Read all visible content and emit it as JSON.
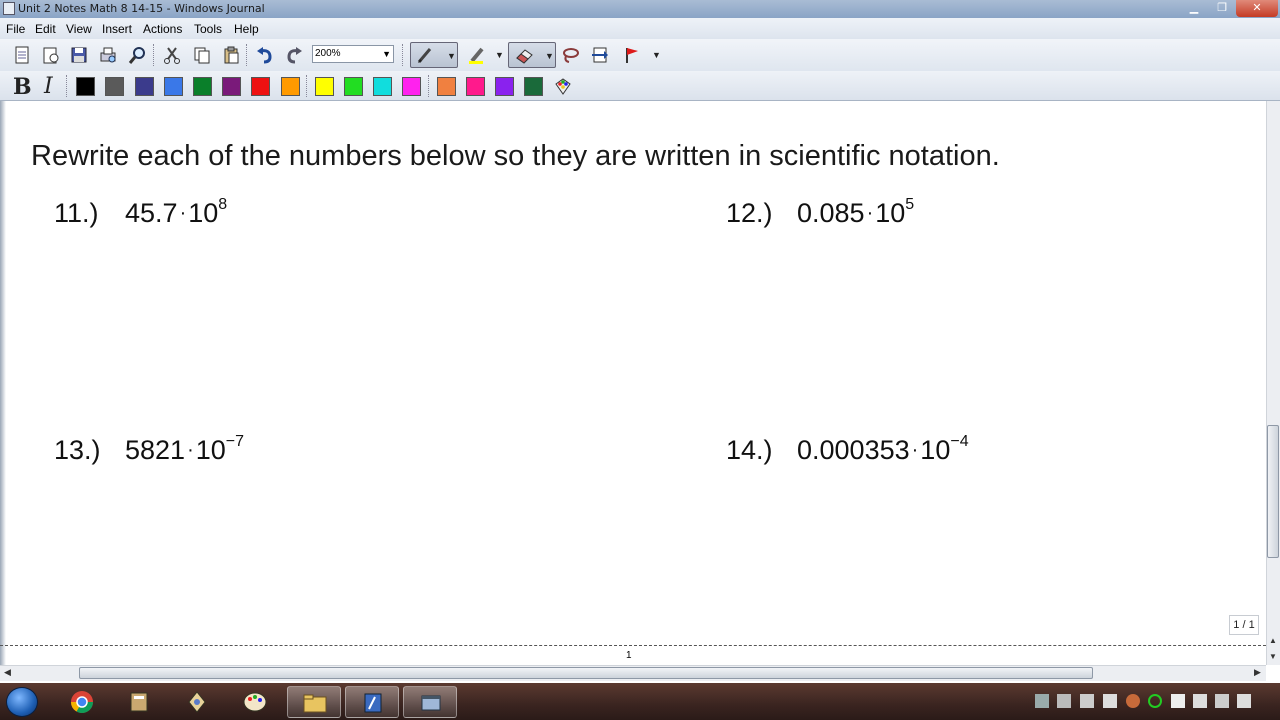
{
  "window": {
    "title": "Unit 2 Notes Math 8 14-15 - Windows Journal"
  },
  "menu": [
    "File",
    "Edit",
    "View",
    "Insert",
    "Actions",
    "Tools",
    "Help"
  ],
  "toolbar": {
    "zoom": "200%"
  },
  "colors": [
    "#000000",
    "#5a5a5a",
    "#3b3b8c",
    "#3a78e8",
    "#0a7f2a",
    "#7a1a7a",
    "#ee1111",
    "#ff9a00",
    "#ffff00",
    "#22dd22",
    "#11dddd",
    "#ff22ee",
    "#f08040",
    "#ff1a8c",
    "#8a22ee",
    "#1a6a3a"
  ],
  "document": {
    "instruction": "Rewrite each of the numbers below so they are written in scientific notation.",
    "problems": [
      {
        "label": "11.)",
        "base": "45.7",
        "ten": "10",
        "exp": "8"
      },
      {
        "label": "12.)",
        "base": "0.085",
        "ten": "10",
        "exp": "5"
      },
      {
        "label": "13.)",
        "base": "5821",
        "ten": "10",
        "exp": "−7"
      },
      {
        "label": "14.)",
        "base": "0.000353",
        "ten": "10",
        "exp": "−4"
      }
    ],
    "page_counter": "1 / 1",
    "page_number": "1"
  }
}
